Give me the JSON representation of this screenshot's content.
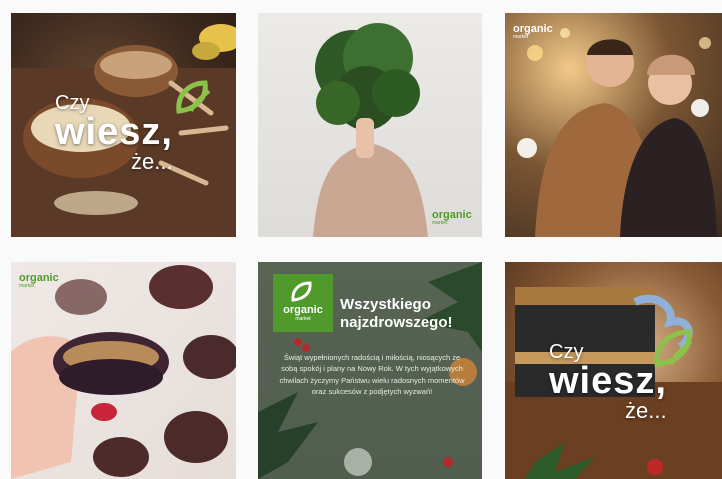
{
  "tiles": {
    "t1": {
      "line1": "Czy",
      "line2": "wiesz,",
      "line3": "że..."
    },
    "t2": {
      "logo": "organic",
      "logo_sub": "market"
    },
    "t3": {
      "logo": "organic",
      "logo_sub": "market"
    },
    "t4": {
      "logo": "organic",
      "logo_sub": "market"
    },
    "t5": {
      "logo": "organic",
      "logo_sub": "market",
      "heading_line1": "Wszystkiego",
      "heading_line2": "najzdrowszego!",
      "body": "Świąt wypełnionych radością i miłością, niosących ze sobą spokój i plany na Nowy Rok. W tych wyjątkowych chwilach życzymy Państwu wielu radosnych momentów oraz sukcesów z podjętych wyzwań!"
    },
    "t6": {
      "line1": "Czy",
      "line2": "wiesz,",
      "line3": "że..."
    }
  },
  "colors": {
    "brand_green": "#4f9a2b",
    "logo_mark_green": "#8bc34a",
    "page_bg": "#fafafa"
  }
}
